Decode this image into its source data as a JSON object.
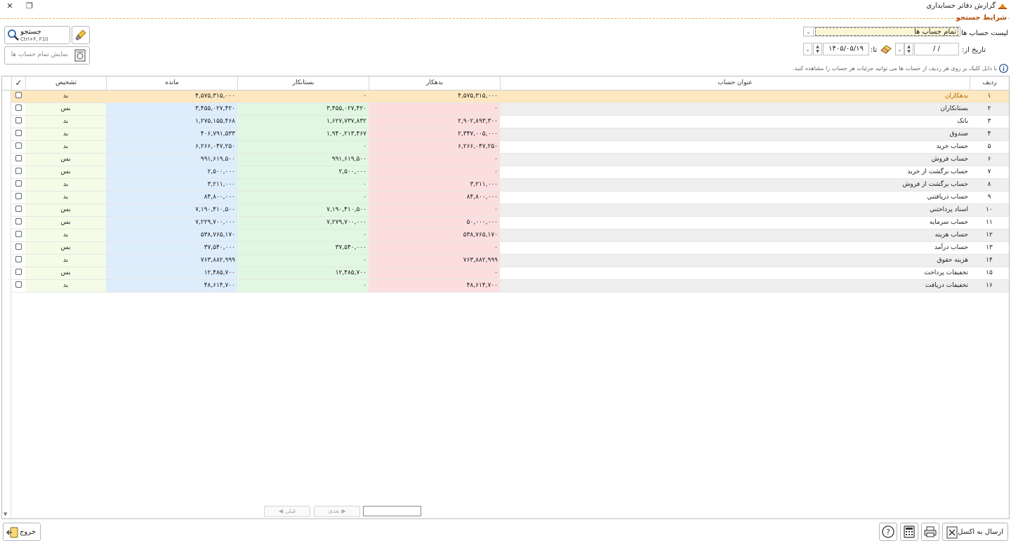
{
  "window": {
    "title": "گزارش دفاتر حسابداری",
    "close_glyph": "✕",
    "restore_glyph": "❐"
  },
  "criteria": {
    "section_title": "شرایط جستجو",
    "account_list_label": "لیست حساب ها:",
    "account_list_value": "تمام حساب ها",
    "date_from_label": "تاریخ از:",
    "date_from_value": "/   /",
    "date_to_label": "تا:",
    "date_to_value": "۱۴۰۵/۰۵/۱۹"
  },
  "toolbar": {
    "search_label": "جستجو",
    "search_shortcut": "Ctrl+F, F10",
    "show_all_label": "نمایش تمام حساب ها"
  },
  "info_text": "با دابل کلیک بر روی هر ردیف از حساب ها می توانید جزئیات هر حساب را مشاهده کنید.",
  "grid": {
    "columns": {
      "check": "✓",
      "diagnosis": "تشخیص",
      "balance": "مانده",
      "creditor": "بستانکار",
      "debtor": "بدهکار",
      "account_title": "عنوان حساب",
      "row": "ردیف"
    },
    "rows": [
      {
        "idx": "۱",
        "title": "بدهکاران",
        "debtor": "۴,۵۷۵,۳۱۵,۰۰۰",
        "creditor": "۰",
        "balance": "۴,۵۷۵,۳۱۵,۰۰۰",
        "diag": "بد"
      },
      {
        "idx": "۲",
        "title": "بستانکاران",
        "debtor": "۰",
        "creditor": "۳,۴۵۵,۰۲۷,۴۲۰",
        "balance": "۳,۴۵۵,۰۲۷,۴۲۰",
        "diag": "بس"
      },
      {
        "idx": "۳",
        "title": "بانک",
        "debtor": "۲,۹۰۲,۸۹۳,۳۰۰",
        "creditor": "۱,۶۲۷,۷۳۷,۸۳۲",
        "balance": "۱,۲۷۵,۱۵۵,۴۶۸",
        "diag": "بد"
      },
      {
        "idx": "۴",
        "title": "صندوق",
        "debtor": "۲,۳۴۷,۰۰۵,۰۰۰",
        "creditor": "۱,۹۴۰,۲۱۳,۴۶۷",
        "balance": "۴۰۶,۷۹۱,۵۳۳",
        "diag": "بد"
      },
      {
        "idx": "۵",
        "title": "حساب خرید",
        "debtor": "۶,۲۶۶,۰۴۷,۲۵۰",
        "creditor": "۰",
        "balance": "۶,۲۶۶,۰۴۷,۲۵۰",
        "diag": "بد"
      },
      {
        "idx": "۶",
        "title": "حساب فروش",
        "debtor": "۰",
        "creditor": "۹۹۱,۶۱۹,۵۰۰",
        "balance": "۹۹۱,۶۱۹,۵۰۰",
        "diag": "بس"
      },
      {
        "idx": "۷",
        "title": "حساب برگشت از خرید",
        "debtor": "۰",
        "creditor": "۲,۵۰۰,۰۰۰",
        "balance": "۲,۵۰۰,۰۰۰",
        "diag": "بس"
      },
      {
        "idx": "۸",
        "title": "حساب برگشت از فروش",
        "debtor": "۳,۲۱۱,۰۰۰",
        "creditor": "۰",
        "balance": "۳,۲۱۱,۰۰۰",
        "diag": "بد"
      },
      {
        "idx": "۹",
        "title": "حساب دريافتني",
        "debtor": "۸۴,۸۰۰,۰۰۰",
        "creditor": "۰",
        "balance": "۸۴,۸۰۰,۰۰۰",
        "diag": "بد"
      },
      {
        "idx": "۱۰",
        "title": "اسناد پرداختني",
        "debtor": "۰",
        "creditor": "۷,۱۹۰,۴۱۰,۵۰۰",
        "balance": "۷,۱۹۰,۴۱۰,۵۰۰",
        "diag": "بس"
      },
      {
        "idx": "۱۱",
        "title": "حساب سرمایه",
        "debtor": "۵۰,۰۰۰,۰۰۰",
        "creditor": "۷,۲۷۹,۷۰۰,۰۰۰",
        "balance": "۷,۲۲۹,۷۰۰,۰۰۰",
        "diag": "بس"
      },
      {
        "idx": "۱۲",
        "title": "حساب هزینه",
        "debtor": "۵۳۸,۷۶۵,۱۷۰",
        "creditor": "۰",
        "balance": "۵۳۸,۷۶۵,۱۷۰",
        "diag": "بد"
      },
      {
        "idx": "۱۳",
        "title": "حساب درآمد",
        "debtor": "۰",
        "creditor": "۳۷,۵۴۰,۰۰۰",
        "balance": "۳۷,۵۴۰,۰۰۰",
        "diag": "بس"
      },
      {
        "idx": "۱۴",
        "title": "هزینه حقوق",
        "debtor": "۷۶۳,۸۸۲,۹۹۹",
        "creditor": "۰",
        "balance": "۷۶۳,۸۸۲,۹۹۹",
        "diag": "بد"
      },
      {
        "idx": "۱۵",
        "title": "تخفیفات پرداخت",
        "debtor": "۰",
        "creditor": "۱۲,۴۸۵,۷۰۰",
        "balance": "۱۲,۴۸۵,۷۰۰",
        "diag": "بس"
      },
      {
        "idx": "۱۶",
        "title": "تخفیفات دریافت",
        "debtor": "۴۸,۶۱۴,۷۰۰",
        "creditor": "۰",
        "balance": "۴۸,۶۱۴,۷۰۰",
        "diag": "بد"
      }
    ]
  },
  "pager": {
    "prev_label": "قبلی",
    "next_label": "بعدی",
    "page_value": ""
  },
  "footer": {
    "exit_label": "خروج",
    "excel_label": "ارسال به اکسل"
  },
  "colors": {
    "accent": "#f0b45e",
    "debtor_bg": "#fcdede",
    "creditor_bg": "#e1f7e1",
    "balance_bg": "#deedfc",
    "selected_row": "#fde7bf"
  }
}
